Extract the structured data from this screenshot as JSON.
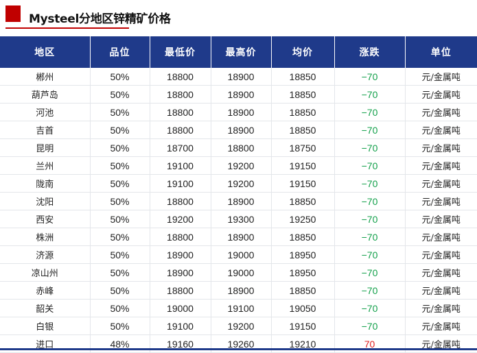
{
  "title": "Mysteel分地区锌精矿价格",
  "colors": {
    "accent": "#c00000",
    "header_bg": "#1f3a8a",
    "down": "#12a04a",
    "up": "#e02020"
  },
  "table": {
    "headers": [
      "地区",
      "品位",
      "最低价",
      "最高价",
      "均价",
      "涨跌",
      "单位"
    ],
    "rows": [
      [
        "郴州",
        "50%",
        "18800",
        "18900",
        "18850",
        "−70",
        "元/金属吨"
      ],
      [
        "葫芦岛",
        "50%",
        "18800",
        "18900",
        "18850",
        "−70",
        "元/金属吨"
      ],
      [
        "河池",
        "50%",
        "18800",
        "18900",
        "18850",
        "−70",
        "元/金属吨"
      ],
      [
        "吉首",
        "50%",
        "18800",
        "18900",
        "18850",
        "−70",
        "元/金属吨"
      ],
      [
        "昆明",
        "50%",
        "18700",
        "18800",
        "18750",
        "−70",
        "元/金属吨"
      ],
      [
        "兰州",
        "50%",
        "19100",
        "19200",
        "19150",
        "−70",
        "元/金属吨"
      ],
      [
        "陇南",
        "50%",
        "19100",
        "19200",
        "19150",
        "−70",
        "元/金属吨"
      ],
      [
        "沈阳",
        "50%",
        "18800",
        "18900",
        "18850",
        "−70",
        "元/金属吨"
      ],
      [
        "西安",
        "50%",
        "19200",
        "19300",
        "19250",
        "−70",
        "元/金属吨"
      ],
      [
        "株洲",
        "50%",
        "18800",
        "18900",
        "18850",
        "−70",
        "元/金属吨"
      ],
      [
        "济源",
        "50%",
        "18900",
        "19000",
        "18950",
        "−70",
        "元/金属吨"
      ],
      [
        "凉山州",
        "50%",
        "18900",
        "19000",
        "18950",
        "−70",
        "元/金属吨"
      ],
      [
        "赤峰",
        "50%",
        "18800",
        "18900",
        "18850",
        "−70",
        "元/金属吨"
      ],
      [
        "韶关",
        "50%",
        "19000",
        "19100",
        "19050",
        "−70",
        "元/金属吨"
      ],
      [
        "白银",
        "50%",
        "19100",
        "19200",
        "19150",
        "−70",
        "元/金属吨"
      ],
      [
        "进口",
        "48%",
        "19160",
        "19260",
        "19210",
        "70",
        "元/金属吨"
      ]
    ],
    "change_direction": [
      "down",
      "down",
      "down",
      "down",
      "down",
      "down",
      "down",
      "down",
      "down",
      "down",
      "down",
      "down",
      "down",
      "down",
      "down",
      "up"
    ]
  }
}
